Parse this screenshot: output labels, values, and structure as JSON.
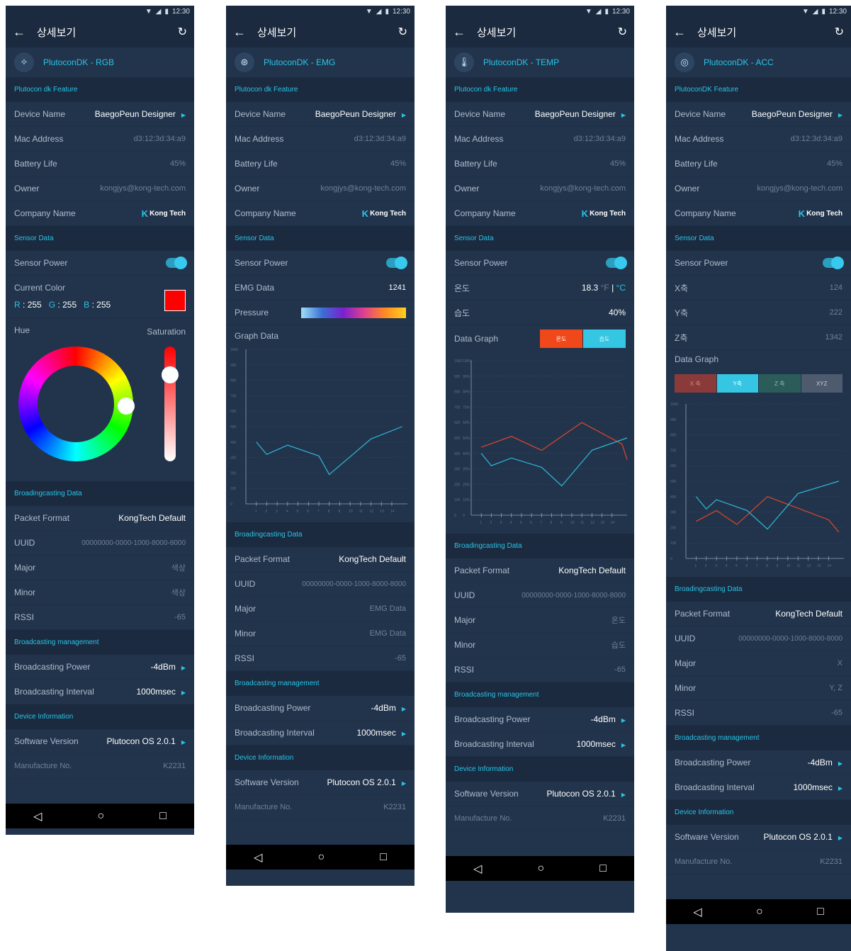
{
  "common": {
    "status_time": "12:30",
    "app_title": "상세보기",
    "labels": {
      "feature": "Plutocon dk Feature",
      "feature_acc": "PlutoconDK Feature",
      "device_name": "Device Name",
      "mac_address": "Mac Address",
      "battery_life": "Battery Life",
      "owner": "Owner",
      "company_name": "Company Name",
      "sensor_data": "Sensor Data",
      "sensor_power": "Sensor Power",
      "broadcasting_data": "Broadingcasting Data",
      "packet_format": "Packet Format",
      "uuid": "UUID",
      "major": "Major",
      "minor": "Minor",
      "rssi": "RSSI",
      "broadcasting_mgmt": "Broadcasting management",
      "broadcasting_power": "Broadcasting Power",
      "broadcasting_interval": "Broadcasting Interval",
      "device_information": "Device Information",
      "software_version": "Software Version",
      "manufacture_no": "Manufacture No."
    },
    "values": {
      "device_name": "BaegoPeun Designer",
      "mac_address": "d3:12:3d:34:a9",
      "battery_life": "45%",
      "owner": "kongjys@kong-tech.com",
      "company_logo": "Kong Tech",
      "packet_format": "KongTech Default",
      "uuid": "00000000-0000-1000-8000-8000",
      "rssi": "-65",
      "broadcasting_power": "-4dBm",
      "broadcasting_interval": "1000msec",
      "software_version": "Plutocon OS 2.0.1",
      "manufacture_no": "K2231"
    },
    "colors": {
      "accent": "#28c4e6",
      "bg": "#22344c",
      "section": "#1b2a3f",
      "red_line": "#e0452a",
      "blue_line": "#2cb8d6"
    }
  },
  "screens": {
    "rgb": {
      "device_title": "PlutoconDK - RGB",
      "icon": "lightbulb-icon",
      "current_color_label": "Current Color",
      "r_label": "R",
      "r_value": "255",
      "g_label": "G",
      "g_value": "255",
      "b_label": "B",
      "b_value": "255",
      "hue_label": "Hue",
      "saturation_label": "Saturation",
      "major_value": "색상",
      "minor_value": "색상",
      "current_color": "#ff0000"
    },
    "emg": {
      "device_title": "PlutoconDK - EMG",
      "icon": "pulse-icon",
      "emg_label": "EMG Data",
      "emg_value": "1241",
      "pressure_label": "Pressure",
      "graph_label": "Graph Data",
      "major_value": "EMG Data",
      "minor_value": "EMG Data"
    },
    "temp": {
      "device_title": "PlutoconDK - TEMP",
      "icon": "thermometer-icon",
      "temp_label": "온도",
      "temp_value": "18.3",
      "unit_f": "°F",
      "unit_sep": "|",
      "unit_c": "°C",
      "hum_label": "습도",
      "hum_value": "40%",
      "graph_label": "Data Graph",
      "btn_temp": "온도",
      "btn_hum": "습도",
      "major_value": "온도",
      "minor_value": "습도"
    },
    "acc": {
      "device_title": "PlutoconDK - ACC",
      "icon": "compass-icon",
      "x_label": "X축",
      "x_value": "124",
      "y_label": "Y축",
      "y_value": "222",
      "z_label": "Z축",
      "z_value": "1342",
      "graph_label": "Data Graph",
      "btn_x": "X 축",
      "btn_y": "Y축",
      "btn_z": "Z 축",
      "btn_xyz": "XYZ",
      "major_value": "X",
      "minor_value": "Y, Z"
    }
  },
  "chart_data": [
    {
      "type": "line",
      "x": [
        1,
        2,
        3,
        4,
        5,
        6,
        7,
        8,
        9,
        10,
        11,
        12,
        13,
        14
      ],
      "ylim": [
        0,
        1000
      ],
      "yticks": [
        0,
        100,
        200,
        300,
        400,
        500,
        600,
        700,
        800,
        900,
        1000
      ],
      "series": [
        {
          "name": "",
          "x": [
            1,
            2,
            4,
            7,
            8,
            12,
            15
          ],
          "values": [
            400,
            320,
            380,
            310,
            190,
            420,
            500
          ]
        }
      ]
    },
    {
      "type": "line",
      "x": [
        1,
        2,
        3,
        4,
        5,
        6,
        7,
        8,
        9,
        10,
        11,
        12,
        13,
        14
      ],
      "ylim": [
        0,
        1000
      ],
      "yticks": [
        0,
        100,
        200,
        300,
        400,
        500,
        600,
        700,
        800,
        900,
        1000
      ],
      "yticks_right": [
        "0",
        "10%",
        "20%",
        "30%",
        "40%",
        "50%",
        "60%",
        "70%",
        "80%",
        "90%",
        "100%"
      ],
      "series": [
        {
          "name": "온도",
          "x": [
            1,
            4,
            7,
            11,
            15,
            15.5
          ],
          "values": [
            440,
            510,
            420,
            600,
            460,
            360
          ]
        },
        {
          "name": "습도",
          "x": [
            1,
            2,
            4,
            7,
            9,
            12,
            15.5
          ],
          "values": [
            400,
            320,
            370,
            310,
            190,
            420,
            500
          ]
        }
      ]
    },
    {
      "type": "line",
      "x": [
        1,
        2,
        3,
        4,
        5,
        6,
        7,
        8,
        9,
        10,
        11,
        12,
        13,
        14
      ],
      "ylim": [
        0,
        1000
      ],
      "yticks": [
        0,
        100,
        200,
        300,
        400,
        500,
        600,
        700,
        800,
        900,
        1000
      ],
      "series": [
        {
          "name": "X 축",
          "x": [
            1,
            3,
            5,
            8,
            14,
            15
          ],
          "values": [
            240,
            310,
            220,
            400,
            250,
            170
          ]
        },
        {
          "name": "Y축",
          "x": [
            1,
            2,
            3,
            6,
            8,
            11,
            15
          ],
          "values": [
            400,
            320,
            380,
            310,
            190,
            420,
            500
          ]
        }
      ]
    }
  ]
}
